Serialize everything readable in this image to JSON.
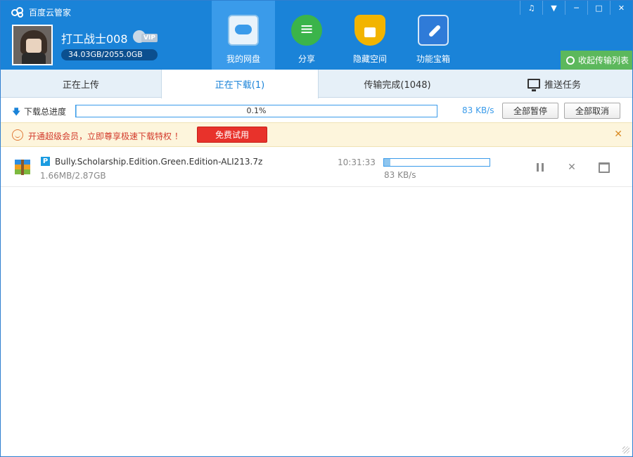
{
  "app": {
    "title": "百度云管家"
  },
  "user": {
    "name": "打工战士008",
    "vip_label": "VIP",
    "quota": "34.03GB/2055.0GB"
  },
  "nav": [
    {
      "label": "我的网盘",
      "icon": "cloud-disk-icon",
      "active": true
    },
    {
      "label": "分享",
      "icon": "share-icon"
    },
    {
      "label": "隐藏空间",
      "icon": "lock-icon"
    },
    {
      "label": "功能宝箱",
      "icon": "tools-icon"
    }
  ],
  "window_controls": [
    "bell-icon",
    "menu-icon",
    "minimize-icon",
    "maximize-icon",
    "close-icon"
  ],
  "collapse_button": "收起传输列表",
  "tabs": [
    {
      "label": "正在上传"
    },
    {
      "label": "正在下载(1)",
      "active": true
    },
    {
      "label": "传输完成(1048)"
    },
    {
      "label": "推送任务",
      "icon": "monitor-icon"
    }
  ],
  "progress": {
    "label": "下载总进度",
    "percent_text": "0.1%",
    "percent": 0.1,
    "speed": "83 KB/s",
    "pause_all": "全部暂停",
    "cancel_all": "全部取消"
  },
  "banner": {
    "text": "开通超级会员，立即尊享极速下载特权 ！",
    "button": "免费试用",
    "close": "✕"
  },
  "downloads": [
    {
      "name": "Bully.Scholarship.Edition.Green.Edition-ALI213.7z",
      "badge": "P",
      "size": "1.66MB/2.87GB",
      "time": "10:31:33",
      "speed": "83 KB/s",
      "progress": 0.06
    }
  ],
  "colors": {
    "header": "#1a83d8",
    "accent": "#3a9bea",
    "banner_bg": "#fdf5dc",
    "trial_red": "#e8322b",
    "collapse_green": "#5cb85c"
  }
}
